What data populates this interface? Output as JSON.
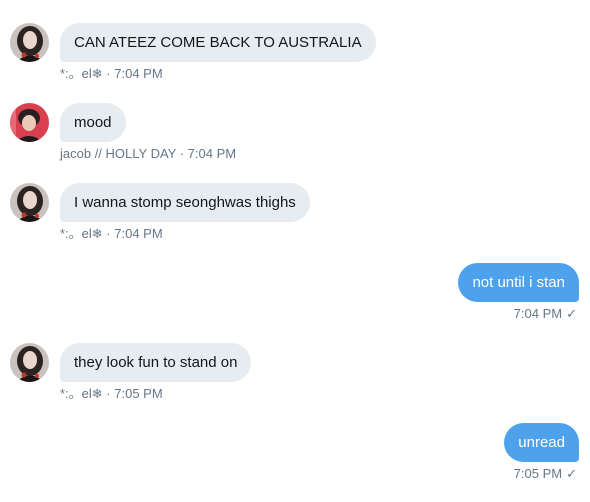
{
  "messages": [
    {
      "text": "CAN ATEEZ COME BACK TO AUSTRALIA",
      "sender": "*:。el❄",
      "time": "7:04 PM",
      "avatar": "avatar-el-icon"
    },
    {
      "text": "mood",
      "sender": "jacob // HOLLY DAY",
      "time": "7:04 PM",
      "avatar": "avatar-jacob-icon"
    },
    {
      "text": "I wanna stomp seonghwas thighs",
      "sender": "*:。el❄",
      "time": "7:04 PM",
      "avatar": "avatar-el-icon"
    },
    {
      "text": "not until i stan",
      "time": "7:04 PM",
      "status_icon": "✓"
    },
    {
      "text": "they look fun to stand on",
      "sender": "*:。el❄",
      "time": "7:05 PM",
      "avatar": "avatar-el-icon"
    },
    {
      "text": "unread",
      "time": "7:05 PM",
      "status_icon": "✓"
    }
  ],
  "separator": " · ",
  "colors": {
    "incoming_bubble": "#e6ecf0",
    "outgoing_bubble": "#4da2eb",
    "meta_text": "#657786"
  }
}
